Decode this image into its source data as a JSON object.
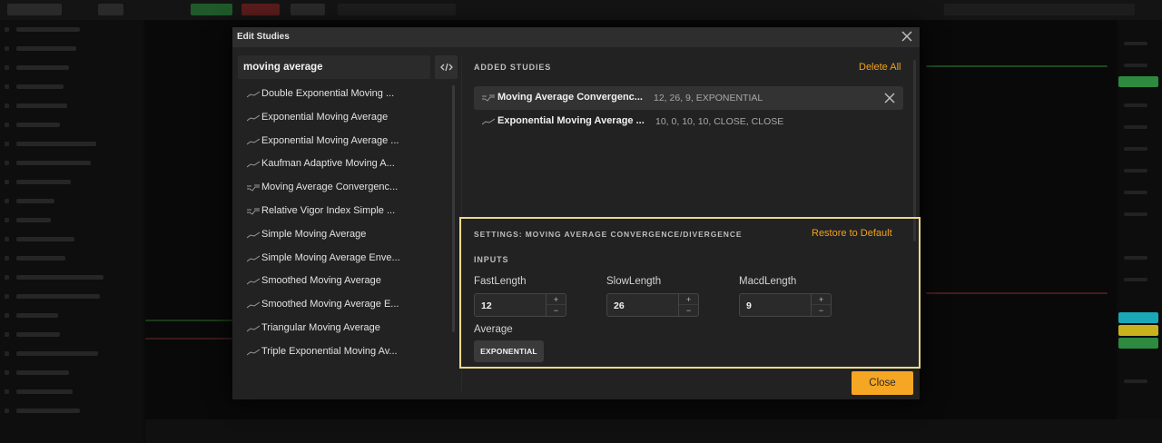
{
  "background": {
    "accent_green": "#2d8a3e",
    "accent_red": "#8a2424"
  },
  "modal": {
    "title": "Edit Studies",
    "close_icon": "close-icon"
  },
  "search": {
    "value": "moving average",
    "placeholder": ""
  },
  "study_list": [
    {
      "label": "Double Exponential Moving ...",
      "icon": "line-icon"
    },
    {
      "label": "Exponential Moving Average",
      "icon": "line-icon"
    },
    {
      "label": "Exponential Moving Average ...",
      "icon": "line-icon"
    },
    {
      "label": "Kaufman Adaptive Moving A...",
      "icon": "line-icon"
    },
    {
      "label": "Moving Average Convergenc...",
      "icon": "histogram-icon"
    },
    {
      "label": "Relative Vigor Index Simple ...",
      "icon": "histogram-icon"
    },
    {
      "label": "Simple Moving Average",
      "icon": "line-icon"
    },
    {
      "label": "Simple Moving Average Enve...",
      "icon": "line-icon"
    },
    {
      "label": "Smoothed Moving Average",
      "icon": "line-icon"
    },
    {
      "label": "Smoothed Moving Average E...",
      "icon": "line-icon"
    },
    {
      "label": "Triangular Moving Average",
      "icon": "line-icon"
    },
    {
      "label": "Triple Exponential Moving Av...",
      "icon": "line-icon"
    }
  ],
  "added": {
    "title": "ADDED STUDIES",
    "delete_all": "Delete All",
    "items": [
      {
        "name": "Moving Average Convergenc...",
        "params": "12, 26, 9, EXPONENTIAL",
        "selected": true
      },
      {
        "name": "Exponential Moving Average ...",
        "params": "10, 0, 10, 10, CLOSE, CLOSE",
        "selected": false
      }
    ]
  },
  "settings": {
    "title": "SETTINGS: MOVING AVERAGE CONVERGENCE/DIVERGENCE",
    "restore": "Restore to Default",
    "inputs_title": "INPUTS",
    "fields": [
      {
        "label": "FastLength",
        "value": "12"
      },
      {
        "label": "SlowLength",
        "value": "26"
      },
      {
        "label": "MacdLength",
        "value": "9"
      }
    ],
    "stepper_up": "+",
    "stepper_down": "−",
    "average_label": "Average",
    "average_value": "EXPONENTIAL",
    "highlight_color": "#ecd98b"
  },
  "footer": {
    "close_label": "Close",
    "close_color": "#f5a623"
  }
}
